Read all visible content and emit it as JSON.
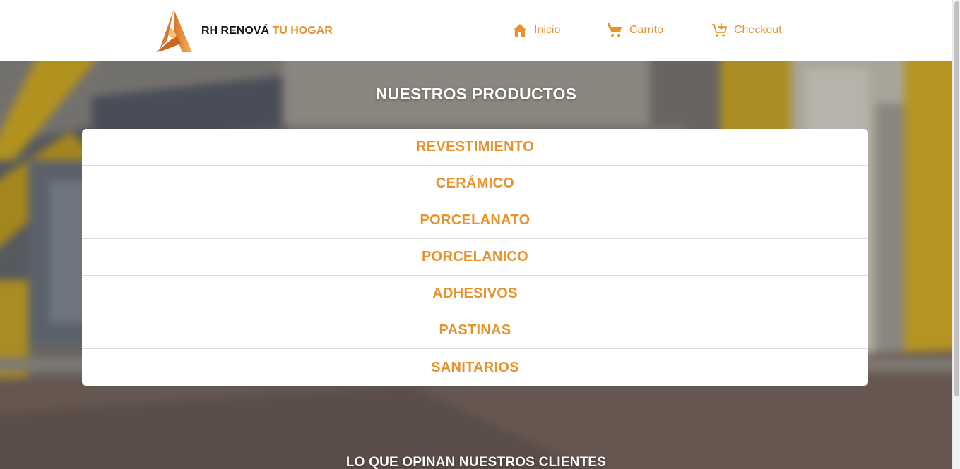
{
  "header": {
    "brand_main": "RH RENOVÁ",
    "brand_accent": "TU HOGAR",
    "nav": {
      "home": "Inicio",
      "cart": "Carrito",
      "checkout": "Checkout"
    }
  },
  "products": {
    "title": "NUESTROS PRODUCTOS",
    "items": [
      "REVESTIMIENTO",
      "CERÁMICO",
      "PORCELANATO",
      "PORCELANICO",
      "ADHESIVOS",
      "PASTINAS",
      "SANITARIOS"
    ]
  },
  "reviews": {
    "title": "LO QUE OPINAN NUESTROS CLIENTES"
  },
  "colors": {
    "accent": "#e8922c",
    "brand_dark": "#111111",
    "background_white": "#ffffff"
  },
  "icons": {
    "home": "home-icon",
    "cart": "cart-icon",
    "checkout": "cart-add-icon"
  }
}
